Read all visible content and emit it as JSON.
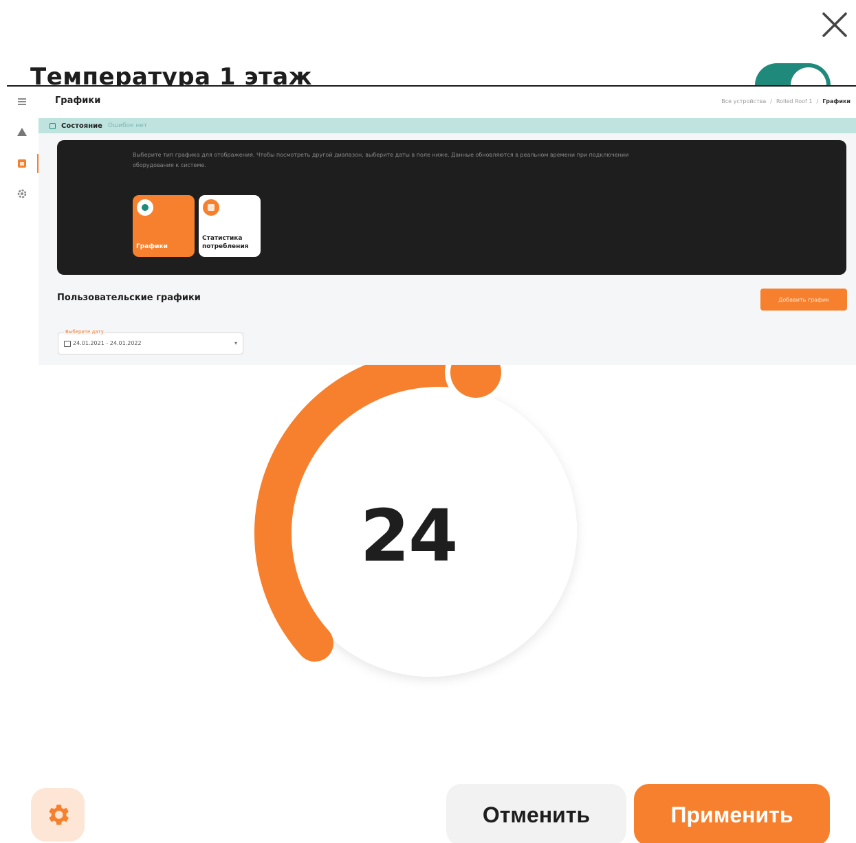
{
  "modal": {
    "title": "Температура 1 этаж",
    "toggle_on": true,
    "dial": {
      "value": "24",
      "arc_color": "#f6802d"
    }
  },
  "footer": {
    "settings_icon": "gear-icon",
    "cancel_label": "Отменить",
    "apply_label": "Применить"
  },
  "screenshot_panel": {
    "sidebar": {
      "items": [
        {
          "icon": "list-icon"
        },
        {
          "icon": "warning-icon"
        },
        {
          "icon": "chart-icon",
          "active": true
        },
        {
          "icon": "gear-icon"
        }
      ]
    },
    "header_title": "Графики",
    "breadcrumb": [
      "Все устройства",
      "Rolled Roof 1",
      "Графики"
    ],
    "status_label": "Состояние",
    "status_text": "Ошибок нет",
    "card_description": "Выберите тип графика для отображения. Чтобы посмотреть другой диапазон, выберите даты в поле ниже. Данные обновляются в реальном времени при подключении оборудования к системе.",
    "tiles": [
      {
        "label": "Графики",
        "icon": "chart-icon"
      },
      {
        "label": "Статистика потребления",
        "icon": "stats-icon"
      }
    ],
    "user_charts_title": "Пользовательские графики",
    "add_chart_label": "Добавить график",
    "date_field": {
      "label": "Выберите дату",
      "value": "24.01.2021 - 24.01.2022"
    },
    "colors": {
      "accent": "#f6802d",
      "teal": "#1f8a7c",
      "dark": "#1e1e1e"
    }
  }
}
